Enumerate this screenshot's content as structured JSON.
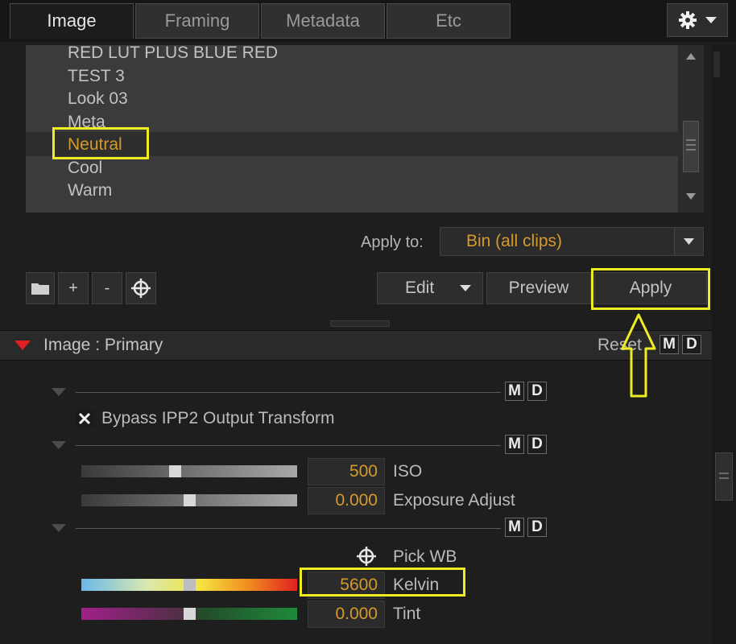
{
  "tabs": [
    {
      "label": "Image",
      "active": true
    },
    {
      "label": "Framing",
      "active": false
    },
    {
      "label": "Metadata",
      "active": false
    },
    {
      "label": "Etc",
      "active": false
    }
  ],
  "looks": {
    "items": [
      "RED LUT PLUS BLUE RED",
      "TEST 3",
      "Look 03",
      "Meta",
      "Neutral",
      "Cool",
      "Warm"
    ],
    "selected": "Neutral"
  },
  "apply_to": {
    "label": "Apply to:",
    "value": "Bin (all clips)"
  },
  "toolbar": {
    "add_label": "+",
    "remove_label": "-",
    "edit_label": "Edit",
    "preview_label": "Preview",
    "apply_label": "Apply"
  },
  "section": {
    "title": "Image : Primary",
    "reset_label": "Reset",
    "m_label": "M",
    "d_label": "D"
  },
  "bypass": {
    "label": "Bypass IPP2 Output Transform",
    "checked": true
  },
  "params": {
    "iso": {
      "value": "500",
      "label": "ISO",
      "slider_fraction": 0.43
    },
    "exposure": {
      "value": "0.000",
      "label": "Exposure Adjust",
      "slider_fraction": 0.5
    },
    "pick_wb_label": "Pick WB",
    "kelvin": {
      "value": "5600",
      "label": "Kelvin",
      "slider_fraction": 0.5
    },
    "tint": {
      "value": "0.000",
      "label": "Tint",
      "slider_fraction": 0.5
    }
  },
  "colors": {
    "accent": "#d59a2a",
    "highlight": "#f0ec24",
    "section_arrow": "#e02020"
  }
}
